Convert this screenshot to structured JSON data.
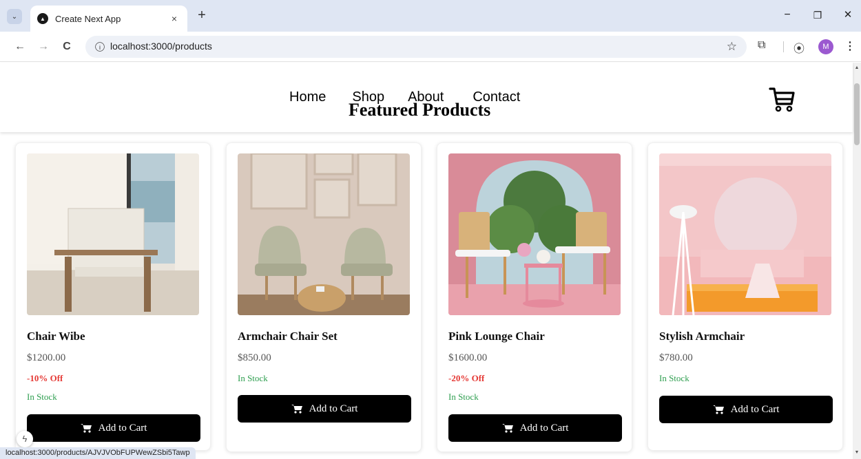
{
  "browser": {
    "tab_title": "Create Next App",
    "tab_close": "×",
    "new_tab": "+",
    "dropdown_icon": "⌄",
    "url": "localhost:3000/products",
    "back": "←",
    "forward": "→",
    "reload": "C",
    "bookmark_star": "☆",
    "extensions": "⧉",
    "performance": "⦿",
    "menu": "⋮",
    "avatar_letter": "M",
    "minimize": "−",
    "restore": "❐",
    "close": "✕",
    "status_url": "localhost:3000/products/AJVJVObFUPWewZSbi5Tawp"
  },
  "site": {
    "nav": [
      "Home",
      "Shop",
      "About",
      "Contact"
    ],
    "title": "Featured Products"
  },
  "products": [
    {
      "name": "Chair Wibe",
      "price": "$1200.00",
      "discount": "-10% Off",
      "stock": "In Stock",
      "button": "Add to Cart"
    },
    {
      "name": "Armchair Chair Set",
      "price": "$850.00",
      "discount": "",
      "stock": "In Stock",
      "button": "Add to Cart"
    },
    {
      "name": "Pink Lounge Chair",
      "price": "$1600.00",
      "discount": "-20% Off",
      "stock": "In Stock",
      "button": "Add to Cart"
    },
    {
      "name": "Stylish Armchair",
      "price": "$780.00",
      "discount": "",
      "stock": "In Stock",
      "button": "Add to Cart"
    }
  ],
  "dev_indicator": "ϟ",
  "colors": {
    "discount": "#e53935",
    "stock": "#2e9e4f",
    "button": "#000000",
    "tabstrip": "#dfe6f3"
  }
}
